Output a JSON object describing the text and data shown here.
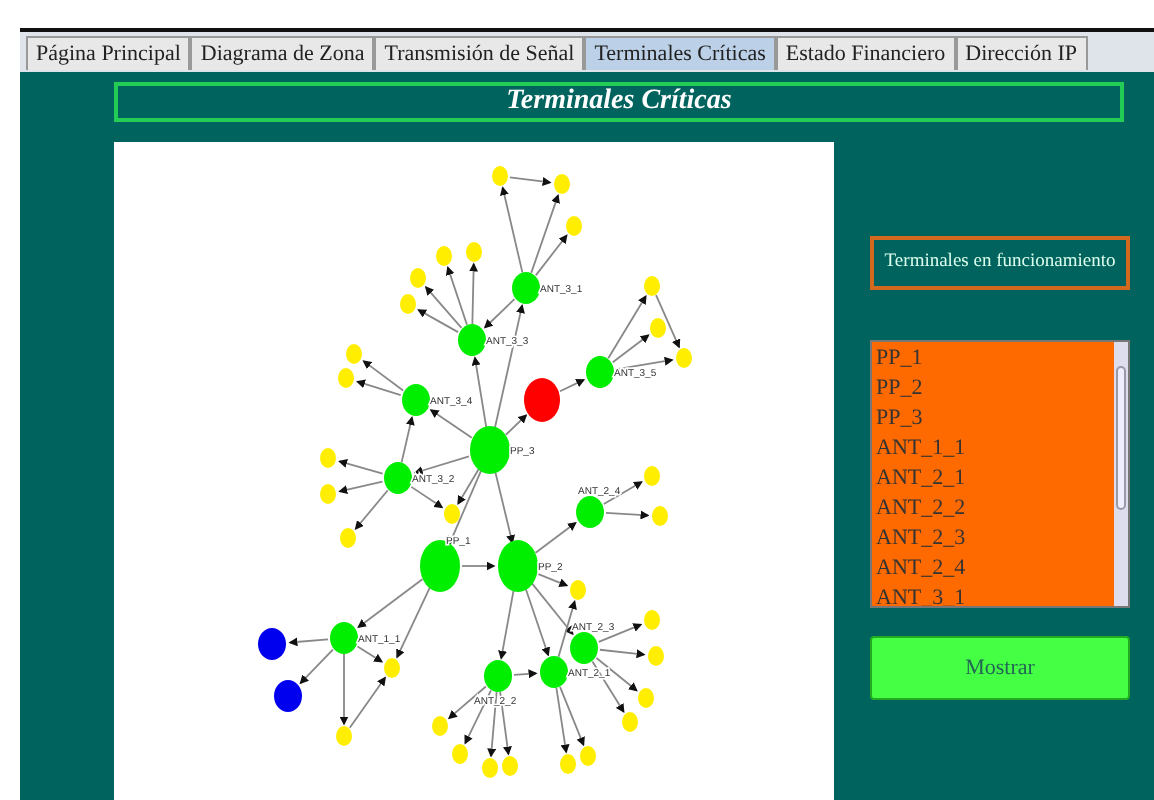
{
  "tabs": [
    {
      "label": "Página Principal",
      "selected": false
    },
    {
      "label": "Diagrama de Zona",
      "selected": false
    },
    {
      "label": "Transmisión de Señal",
      "selected": false
    },
    {
      "label": "Terminales Críticas",
      "selected": true
    },
    {
      "label": "Estado Financiero",
      "selected": false
    },
    {
      "label": "Dirección IP",
      "selected": false
    }
  ],
  "title": "Terminales Críticas",
  "graph": {
    "nodes": [
      {
        "color": "#ffee00"
      },
      {
        "color": "#ffee00"
      },
      {
        "color": "#ffee00"
      },
      {
        "color": "#ffee00"
      },
      {
        "color": "#ffee00"
      },
      {
        "color": "#ffee00"
      },
      {
        "color": "#ffee00"
      },
      {
        "label": "ANT_3_1",
        "color": "#00ee00"
      },
      {
        "color": "#ffee00"
      },
      {
        "color": "#ffee00"
      },
      {
        "label": "ANT_3_3",
        "color": "#00ee00"
      },
      {
        "color": "#ffee00"
      },
      {
        "color": "#ffee00"
      },
      {
        "label": "ANT_3_5",
        "color": "#00ee00"
      },
      {
        "color": "#ffee00"
      },
      {
        "label": "ANT_3_4",
        "color": "#00ee00"
      },
      {
        "color": "#ff0000"
      },
      {
        "label": "PP_3",
        "color": "#00ee00"
      },
      {
        "color": "#ffee00"
      },
      {
        "color": "#ffee00"
      },
      {
        "label": "ANT_3_2",
        "color": "#00ee00"
      },
      {
        "color": "#ffee00"
      },
      {
        "label": "ANT_2_4",
        "color": "#00ee00"
      },
      {
        "color": "#ffee00"
      },
      {
        "color": "#ffee00"
      },
      {
        "color": "#ffee00"
      },
      {
        "label": "PP_1",
        "color": "#00ee00"
      },
      {
        "label": "PP_2",
        "color": "#00ee00"
      },
      {
        "color": "#ffee00"
      },
      {
        "color": "#ffee00"
      },
      {
        "label": "ANT_1_1",
        "color": "#00ee00"
      },
      {
        "color": "#0000ee"
      },
      {
        "label": "ANT_2_3",
        "color": "#00ee00"
      },
      {
        "color": "#ffee00"
      },
      {
        "color": "#ffee00"
      },
      {
        "label": "ANT_2_1",
        "color": "#00ee00"
      },
      {
        "label": "ANT_2_2",
        "color": "#00ee00"
      },
      {
        "color": "#0000ee"
      },
      {
        "color": "#ffee00"
      },
      {
        "color": "#ffee00"
      },
      {
        "color": "#ffee00"
      },
      {
        "color": "#ffee00"
      },
      {
        "color": "#ffee00"
      },
      {
        "color": "#ffee00"
      },
      {
        "color": "#ffee00"
      },
      {
        "color": "#ffee00"
      },
      {
        "color": "#ffee00"
      }
    ]
  },
  "legend_title": "Terminales en funcionamiento",
  "terminals": [
    "PP_1",
    "PP_2",
    "PP_3",
    "ANT_1_1",
    "ANT_2_1",
    "ANT_2_2",
    "ANT_2_3",
    "ANT_2_4",
    "ANT_3_1"
  ],
  "button": "Mostrar"
}
